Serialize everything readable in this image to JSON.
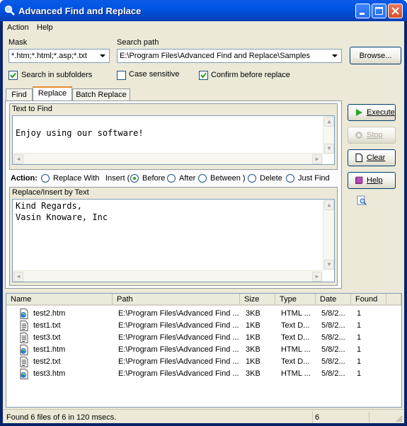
{
  "window": {
    "title": "Advanced Find and Replace"
  },
  "menu": {
    "items": [
      "Action",
      "Help"
    ]
  },
  "mask": {
    "label": "Mask",
    "value": "*.htm;*.html;*.asp;*.txt"
  },
  "search_path": {
    "label": "Search path",
    "value": "E:\\Program Files\\Advanced Find and Replace\\Samples"
  },
  "browse_label": "Browse...",
  "options": {
    "subfolders": {
      "label": "Search in subfolders",
      "checked": true
    },
    "case_sensitive": {
      "label": "Case sensitive",
      "checked": false
    },
    "confirm": {
      "label": "Confirm before replace",
      "checked": true
    }
  },
  "tabs": [
    "Find",
    "Replace",
    "Batch Replace"
  ],
  "active_tab": "Replace",
  "text_to_find": {
    "label": "Text to Find",
    "value": "Enjoy using our software!"
  },
  "action": {
    "label": "Action:",
    "replace_with": "Replace With",
    "insert_prefix": "Insert (",
    "before": "Before",
    "after": "After",
    "between": "Between )",
    "delete": "Delete",
    "just_find": "Just Find",
    "selected": "Before"
  },
  "replace_text": {
    "label": "Replace/Insert by Text",
    "line1": "Kind Regards,",
    "line2": "Vasin Knoware, Inc"
  },
  "side_buttons": {
    "execute": "Execute",
    "stop": "Stop",
    "clear": "Clear",
    "help": "Help"
  },
  "results": {
    "columns": [
      "Name",
      "Path",
      "Size",
      "Type",
      "Date",
      "Found"
    ],
    "rows": [
      {
        "name": "test2.htm",
        "path": "E:\\Program Files\\Advanced Find ...",
        "size": "3KB",
        "type": "HTML ...",
        "date": "5/8/2...",
        "found": "1",
        "icon": "html-file-icon"
      },
      {
        "name": "test1.txt",
        "path": "E:\\Program Files\\Advanced Find ...",
        "size": "1KB",
        "type": "Text D...",
        "date": "5/8/2...",
        "found": "1",
        "icon": "text-file-icon"
      },
      {
        "name": "test3.txt",
        "path": "E:\\Program Files\\Advanced Find ...",
        "size": "1KB",
        "type": "Text D...",
        "date": "5/8/2...",
        "found": "1",
        "icon": "text-file-icon"
      },
      {
        "name": "test1.htm",
        "path": "E:\\Program Files\\Advanced Find ...",
        "size": "3KB",
        "type": "HTML ...",
        "date": "5/8/2...",
        "found": "1",
        "icon": "html-file-icon"
      },
      {
        "name": "test2.txt",
        "path": "E:\\Program Files\\Advanced Find ...",
        "size": "1KB",
        "type": "Text D...",
        "date": "5/8/2...",
        "found": "1",
        "icon": "text-file-icon"
      },
      {
        "name": "test3.htm",
        "path": "E:\\Program Files\\Advanced Find ...",
        "size": "3KB",
        "type": "HTML ...",
        "date": "5/8/2...",
        "found": "1",
        "icon": "html-file-icon"
      }
    ]
  },
  "status": {
    "message": "Found 6 files of 6 in 120 msecs.",
    "count": "6"
  },
  "colors": {
    "title_bar": "#0054e3",
    "window_bg": "#ece9d8",
    "accent_tab": "#e68b2c"
  }
}
